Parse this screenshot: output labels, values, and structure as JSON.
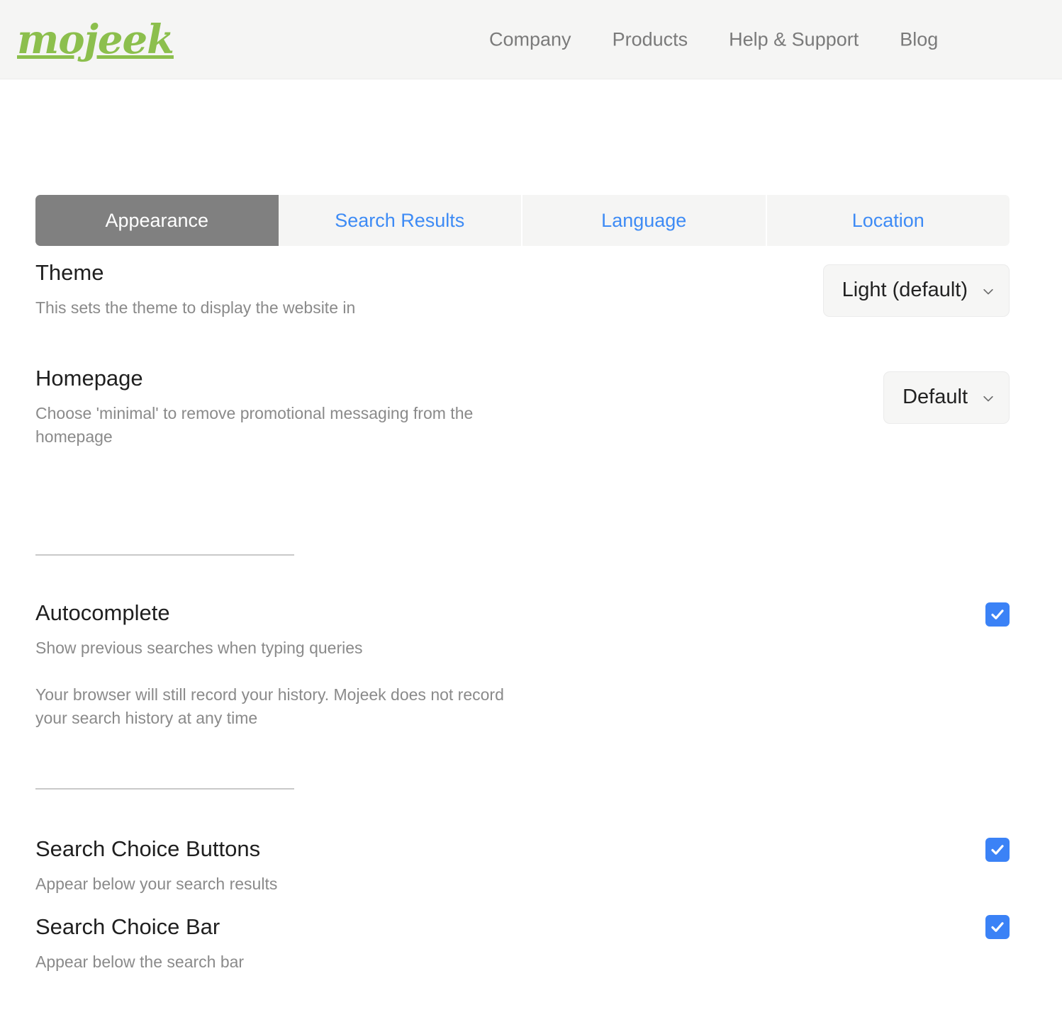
{
  "header": {
    "brand": "mojeek",
    "nav": [
      {
        "label": "Company"
      },
      {
        "label": "Products"
      },
      {
        "label": "Help & Support"
      },
      {
        "label": "Blog"
      }
    ]
  },
  "tabs": [
    {
      "label": "Appearance",
      "active": true
    },
    {
      "label": "Search Results",
      "active": false
    },
    {
      "label": "Language",
      "active": false
    },
    {
      "label": "Location",
      "active": false
    }
  ],
  "settings": {
    "theme": {
      "title": "Theme",
      "desc": "This sets the theme to display the website in",
      "value": "Light (default)"
    },
    "homepage": {
      "title": "Homepage",
      "desc": "Choose 'minimal' to remove promotional messaging from the homepage",
      "value": "Default"
    },
    "autocomplete": {
      "title": "Autocomplete",
      "desc": "Show previous searches when typing queries",
      "note": "Your browser will still record your history. Mojeek does not record your search history at any time",
      "checked": "true"
    },
    "search_choice_buttons": {
      "title": "Search Choice Buttons",
      "desc": "Appear below your search results",
      "checked": "true"
    },
    "search_choice_bar": {
      "title": "Search Choice Bar",
      "desc": "Appear below the search bar",
      "checked": "true"
    }
  },
  "colors": {
    "brand_green": "#8cbf4d",
    "tab_active_bg": "#808080",
    "tab_link": "#3e8bf5",
    "checkbox_blue": "#3b82f6",
    "header_bg": "#f5f5f4"
  }
}
